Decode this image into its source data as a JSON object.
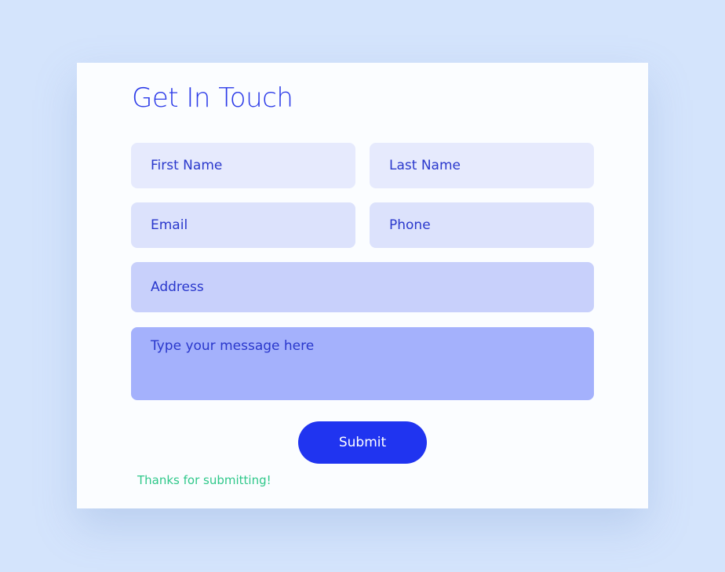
{
  "form": {
    "title": "Get In Touch",
    "fields": {
      "first_name": "First Name",
      "last_name": "Last Name",
      "email": "Email",
      "phone": "Phone",
      "address": "Address",
      "message": "Type your message here"
    },
    "submit_label": "Submit",
    "success_message": "Thanks for submitting!"
  },
  "colors": {
    "page_background": "#d4e4fc",
    "card_background": "#fbfdff",
    "accent": "#2034f0",
    "title": "#2b3ae8",
    "field_text": "#2a38cc",
    "success": "#2fc88a"
  }
}
